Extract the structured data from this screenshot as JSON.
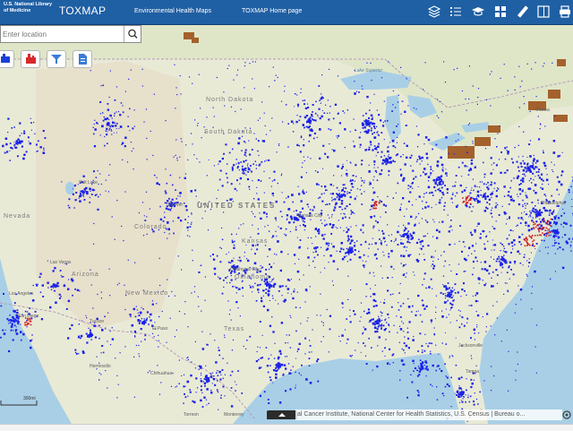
{
  "header": {
    "nlm_label": "U.S. National Library of Medicine",
    "brand": "TOXMAP",
    "nav": [
      "Environmental Health Maps",
      "TOXMAP Home page"
    ],
    "toolbar_icons": [
      "layers-icon",
      "legend-list-icon",
      "learn-icon",
      "basemap-gallery-icon",
      "measure-icon",
      "panel-toggle-icon",
      "print-icon"
    ]
  },
  "search": {
    "placeholder": "Enter location",
    "icon": "search-icon"
  },
  "layer_buttons": [
    {
      "icon": "facility-blue-icon",
      "color": "#1a3fd6"
    },
    {
      "icon": "facility-red-icon",
      "color": "#d62a2a"
    },
    {
      "icon": "filter-icon",
      "color": "#3a7bd5"
    },
    {
      "icon": "report-icon",
      "color": "#3a7bd5"
    }
  ],
  "map": {
    "country_label": "UNITED STATES",
    "states": [
      "North Dakota",
      "South Dakota",
      "Nevada",
      "Colorado",
      "Arizona",
      "New Mexico",
      "Kansas",
      "Oklahoma",
      "Texas"
    ],
    "cities": [
      "Salt Lake",
      "Denver",
      "Las Vegas",
      "Los Angeles",
      "San Diego",
      "Tucson",
      "El Paso",
      "Oklahoma City",
      "Kansas City",
      "Jacksonville",
      "Tampa",
      "Ottawa",
      "Philadelphia",
      "Chihuahua",
      "Hermosillo",
      "Monterrey",
      "Torreon"
    ],
    "waters": [
      "Lake Superior"
    ],
    "colors": {
      "sites": "#1a22e8",
      "superfund": "#d02020",
      "urban": "#9a4a10",
      "water": "#a9cfe6",
      "land": "#e9ead6"
    }
  },
  "scale_label": "300mi",
  "attribution": "al Cancer Institute, National Center for Health Statistics, U.S. Census | Bureau o...",
  "esri_logo": "esri-logo-icon"
}
